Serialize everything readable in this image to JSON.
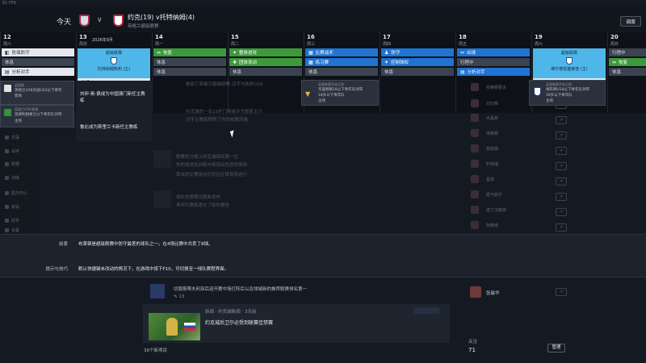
{
  "fps_label": "61 FPS",
  "header": {
    "today_label": "今天",
    "match_title": "约克(19) v托特纳姆(4)",
    "competition": "英格兰超级联赛",
    "button_label": "调度"
  },
  "calendar": {
    "days": [
      {
        "num": "12",
        "name": "周六"
      },
      {
        "num": "13",
        "name": "周日",
        "extra": "2026年9月"
      },
      {
        "num": "14",
        "name": "周一"
      },
      {
        "num": "15",
        "name": "周二"
      },
      {
        "num": "16",
        "name": "周三"
      },
      {
        "num": "17",
        "name": "周四"
      },
      {
        "num": "18",
        "name": "周五"
      },
      {
        "num": "19",
        "name": "周六"
      },
      {
        "num": "20",
        "name": "周日"
      }
    ],
    "events": {
      "d12": [
        "防填防守",
        "休息",
        "分析对手"
      ],
      "d14": [
        "恢复",
        "休息",
        "休息"
      ],
      "d15": [
        "整体进攻",
        "团体发动",
        "休息"
      ],
      "d16": [
        "比赛战术",
        "练习赛",
        "休息"
      ],
      "d17": [
        "防守",
        "控制球权",
        "休息"
      ],
      "d18": [
        "出球",
        "行程中",
        "分析对手"
      ],
      "d20": [
        "行程中",
        "恢复",
        "休息"
      ]
    },
    "match_tiles": {
      "d13": {
        "top": "超级联赛",
        "mid": "托特纳姆热刺 (主)",
        "bottom": "主场"
      },
      "d19": {
        "top": "超级联赛",
        "mid": "维尔德雷塞索普 (主)",
        "bottom": "客场"
      }
    }
  },
  "popups": {
    "p1": {
      "line1": "英超俱",
      "line2": "英格兰U18对战U23以下青年",
      "line3": "客场"
    },
    "p2": {
      "line1": "英格兰U18 联赛",
      "line2": "温德利相格兰以下青年队对阵",
      "line3": "主场"
    },
    "p3": {
      "line1": "英超联赛开始之前",
      "line2": "华盛顿联18以下青年队对阵",
      "line3": "18岁以下青年队",
      "line4": "主场"
    },
    "p4": {
      "line1": "英超联赛开始之前",
      "line2": "胡布顿U18以下青年队对阵",
      "line3": "18岁以下青年队",
      "line4": "主场"
    }
  },
  "news": {
    "item1": "刘伊·奥-佩成为中国澳门新任主教练",
    "item2": "鲁比成为斯里兰卡新任主教练"
  },
  "sidebar_nav": [
    "仿事",
    "战术",
    "数据",
    "训练",
    "医疗中心",
    "转会",
    "财务",
    "设置"
  ],
  "ghost_text": {
    "g1": "参加了英格兰超级联赛-对手与热刺U18",
    "g2": "约克城的一名19岁门将被评为国家主力",
    "g3": "对手主教练称赞了你的执教风格",
    "g4": "联赛积分榜上约克城保持第一位",
    "g5": "你的球员在训练中表现出色获得表扬",
    "g6": "周末的比赛将在约克社区体育场进行",
    "g7": "球队伤病情况更新发布",
    "g8": "青年队教练递交了新的报告"
  },
  "right_panel": {
    "clubs": [
      "布莱顿霍夫",
      "切尔西",
      "水晶宫",
      "埃弗顿",
      "富勒姆",
      "利物浦",
      "曼城",
      "纽卡斯尔",
      "诺丁汉森林",
      "阿森纳",
      "热刺",
      "狼队"
    ],
    "bottom_name": "张晨华"
  },
  "notification_band": {
    "row1_label": "前景",
    "row1_text": "布莱顿是超级联赛中防守最差的球队之一。在4场比赛中共丢了8球。",
    "row2_label": "提示与技巧",
    "row2_text": "默认快捷键未改动的情况下，在游戏中按下F10，可切换至一线队赛程界面。"
  },
  "lower": {
    "headline_preview": "切恩斯蒂夫利亚后迎开赛中场打阵后以及领域新的推荐联赛排名第一",
    "feed_meta": "新闻 · 约克城新闻 · 3天前",
    "feed_title": "约克城后卫尔必受到联赛佳禁赛",
    "comments": "13",
    "shared_count": "39个新项目",
    "right_label": "关注",
    "right_count": "71",
    "manage_button": "管理"
  }
}
